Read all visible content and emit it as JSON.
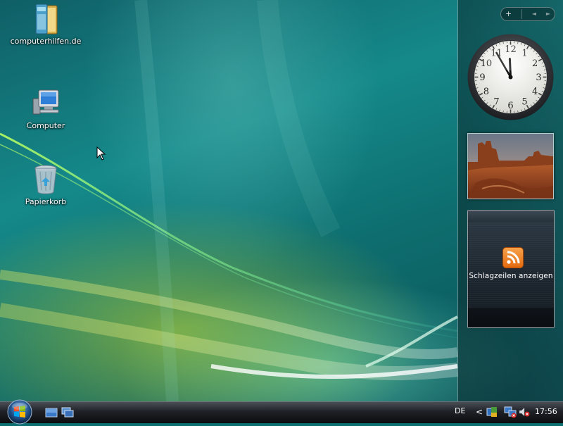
{
  "desktop": {
    "icons": [
      {
        "label": "computerhilfen.de",
        "icon": "folder-book-icon"
      },
      {
        "label": "Computer",
        "icon": "computer-icon"
      },
      {
        "label": "Papierkorb",
        "icon": "recycle-bin-icon"
      }
    ]
  },
  "sidebar": {
    "add_button": "+",
    "prev_button": "◄",
    "next_button": "►",
    "clock": {
      "time": "11:55",
      "hour": 11,
      "minute": 55
    },
    "feed": {
      "text": "Schlagzeilen anzeigen",
      "icon": "rss-icon"
    }
  },
  "taskbar": {
    "start_icon": "windows-orb-icon",
    "quicklaunch": [
      "show-desktop-icon",
      "switch-windows-icon"
    ],
    "language": "DE",
    "tray_expand": "<",
    "time": "17:56"
  },
  "colors": {
    "desktop_teal": "#15898a",
    "accent_green": "#cddc28",
    "rss_orange": "#e36a10"
  }
}
